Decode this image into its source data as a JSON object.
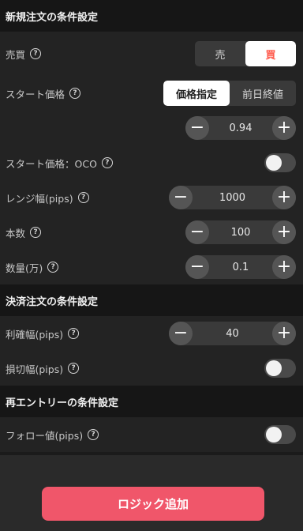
{
  "sections": {
    "new_order": "新規注文の条件設定",
    "settle_order": "決済注文の条件設定",
    "reentry": "再エントリーの条件設定"
  },
  "help_glyph": "?",
  "buy_sell": {
    "label": "売買",
    "sell": "売",
    "buy": "買",
    "selected": "買"
  },
  "start_price": {
    "label": "スタート価格",
    "option_specified": "価格指定",
    "option_prev_close": "前日終値",
    "selected": "価格指定",
    "value": "0.94"
  },
  "start_price_oco": {
    "label": "スタート価格：OCO",
    "enabled": false
  },
  "range_width": {
    "label": "レンジ幅(pips)",
    "value": "1000"
  },
  "count": {
    "label": "本数",
    "value": "100"
  },
  "quantity": {
    "label": "数量(万)",
    "value": "0.1"
  },
  "take_profit": {
    "label": "利確幅(pips)",
    "value": "40"
  },
  "stop_loss": {
    "label": "損切幅(pips)",
    "enabled": false
  },
  "follow_value": {
    "label": "フォロー値(pips)",
    "enabled": false
  },
  "stepper": {
    "minus": "−",
    "plus": "+"
  },
  "footer": {
    "add_logic": "ロジック追加"
  },
  "colors": {
    "accent": "#f0566a",
    "buy": "#ff5a4c",
    "background": "#1b1b1b",
    "row": "#232323"
  }
}
